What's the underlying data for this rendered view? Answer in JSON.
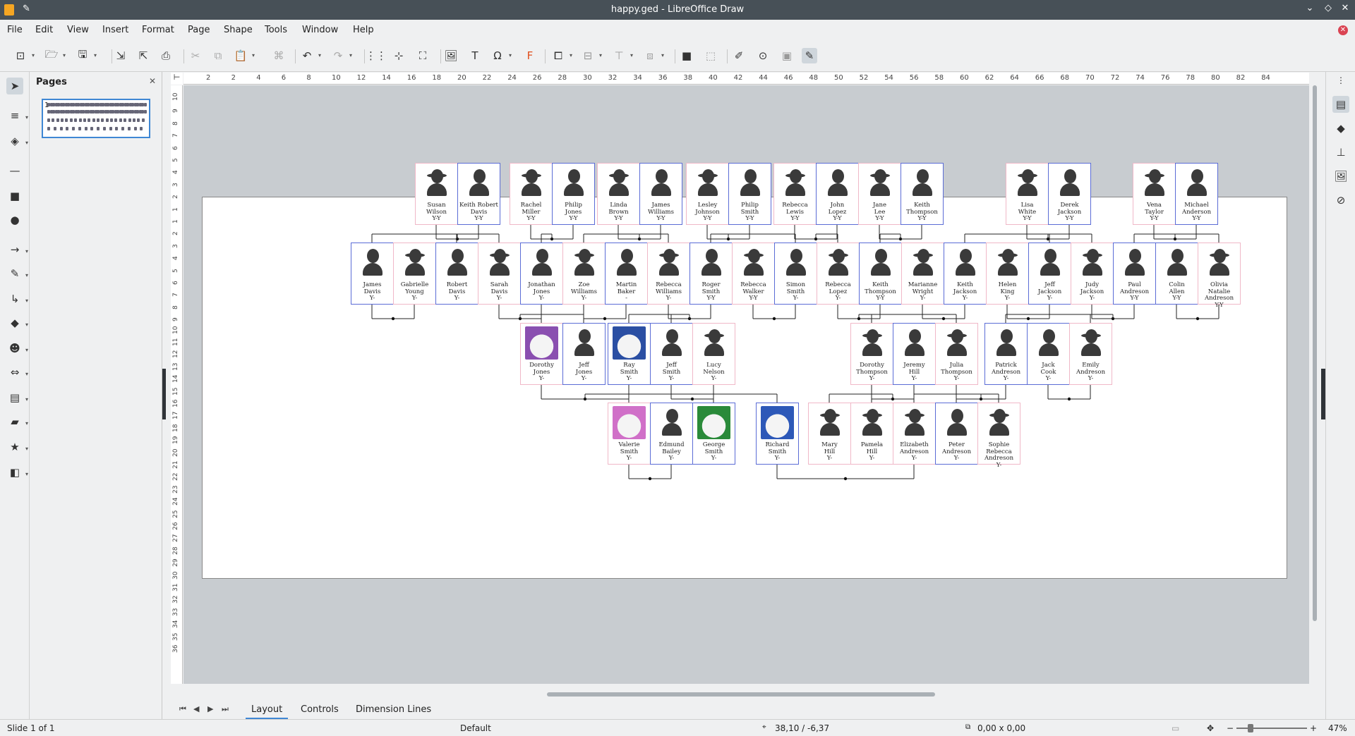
{
  "window": {
    "title": "happy.ged - LibreOffice Draw"
  },
  "menu": [
    "File",
    "Edit",
    "View",
    "Insert",
    "Format",
    "Page",
    "Shape",
    "Tools",
    "Window",
    "Help"
  ],
  "pages_panel": {
    "title": "Pages",
    "page_number": "1"
  },
  "ruler_h": [
    "2",
    "2",
    "4",
    "6",
    "8",
    "10",
    "12",
    "14",
    "16",
    "18",
    "20",
    "22",
    "24",
    "26",
    "28",
    "30",
    "32",
    "34",
    "36",
    "38",
    "40",
    "42",
    "44",
    "46",
    "48",
    "50",
    "52",
    "54",
    "56",
    "58",
    "60",
    "62",
    "64",
    "66",
    "68",
    "70",
    "72",
    "74",
    "76",
    "78",
    "80",
    "82",
    "84"
  ],
  "ruler_v": [
    "10",
    "9",
    "8",
    "7",
    "6",
    "5",
    "4",
    "3",
    "2",
    "1",
    "1",
    "2",
    "3",
    "4",
    "5",
    "6",
    "7",
    "8",
    "9",
    "10",
    "11",
    "12",
    "13",
    "14",
    "15",
    "16",
    "17",
    "18",
    "19",
    "20",
    "21",
    "22",
    "23",
    "24",
    "25",
    "26",
    "27",
    "28",
    "29",
    "30",
    "31",
    "32",
    "33",
    "34",
    "35",
    "36"
  ],
  "people": {
    "g1": [
      {
        "name": "Susan\nWilson\nY-Y",
        "sex": "f"
      },
      {
        "name": "Keith Robert\nDavis\nY-Y",
        "sex": "m"
      },
      {
        "name": "Rachel\nMiller\nY-Y",
        "sex": "f"
      },
      {
        "name": "Philip\nJones\nY-Y",
        "sex": "m"
      },
      {
        "name": "Linda\nBrown\nY-Y",
        "sex": "f"
      },
      {
        "name": "James\nWilliams\nY-Y",
        "sex": "m"
      },
      {
        "name": "Lesley\nJohnson\nY-Y",
        "sex": "f"
      },
      {
        "name": "Philip\nSmith\nY-Y",
        "sex": "m"
      },
      {
        "name": "Rebecca\nLewis\nY-Y",
        "sex": "f"
      },
      {
        "name": "John\nLopez\nY-Y",
        "sex": "m"
      },
      {
        "name": "Jane\nLee\nY-Y",
        "sex": "f"
      },
      {
        "name": "Keith\nThompson\nY-Y",
        "sex": "m"
      },
      {
        "name": "Lisa\nWhite\nY-Y",
        "sex": "f"
      },
      {
        "name": "Derek\nJackson\nY-Y",
        "sex": "m"
      },
      {
        "name": "Vena\nTaylor\nY-Y",
        "sex": "f"
      },
      {
        "name": "Michael\nAnderson\nY-Y",
        "sex": "m"
      }
    ],
    "g2": [
      {
        "name": "James\nDavis\nY-",
        "sex": "m"
      },
      {
        "name": "Gabrielle\nYoung\nY-",
        "sex": "f"
      },
      {
        "name": "Robert\nDavis\nY-",
        "sex": "m"
      },
      {
        "name": "Sarah\nDavis\nY-",
        "sex": "f"
      },
      {
        "name": "Jonathan\nJones\nY-",
        "sex": "m"
      },
      {
        "name": "Zoe\nWilliams\nY-",
        "sex": "f"
      },
      {
        "name": "Martin\nBaker\n-",
        "sex": "m"
      },
      {
        "name": "Rebecca\nWilliams\nY-",
        "sex": "f"
      },
      {
        "name": "Roger\nSmith\nY-Y",
        "sex": "m"
      },
      {
        "name": "Rebecca\nWalker\nY-Y",
        "sex": "f"
      },
      {
        "name": "Simon\nSmith\nY-",
        "sex": "m"
      },
      {
        "name": "Rebecca\nLopez\nY-",
        "sex": "f"
      },
      {
        "name": "Keith\nThompson\nY-Y",
        "sex": "m"
      },
      {
        "name": "Marianne\nWright\nY-",
        "sex": "f"
      },
      {
        "name": "Keith\nJackson\nY-",
        "sex": "m"
      },
      {
        "name": "Helen\nKing\nY-",
        "sex": "f"
      },
      {
        "name": "Jeff\nJackson\nY-",
        "sex": "m"
      },
      {
        "name": "Judy\nJackson\nY-",
        "sex": "f"
      },
      {
        "name": "Paul\nAndreson\nY-Y",
        "sex": "m"
      },
      {
        "name": "Colin\nAllen\nY-Y",
        "sex": "m"
      },
      {
        "name": "Olivia Natalie\nAndreson\nY-Y",
        "sex": "f"
      }
    ],
    "g3": [
      {
        "name": "Dorothy\nJones\nY-",
        "sex": "f",
        "photo": "dorothy"
      },
      {
        "name": "Jeff\nJones\nY-",
        "sex": "m"
      },
      {
        "name": "Ray\nSmith\nY-",
        "sex": "m",
        "photo": "ray"
      },
      {
        "name": "Jeff\nSmith\nY-",
        "sex": "m"
      },
      {
        "name": "Lucy\nNelson\nY-",
        "sex": "f"
      },
      {
        "name": "Dorothy\nThompson\nY-",
        "sex": "f"
      },
      {
        "name": "Jeremy\nHill\nY-",
        "sex": "m"
      },
      {
        "name": "Julia\nThompson\nY-",
        "sex": "f"
      },
      {
        "name": "Patrick\nAndreson\nY-",
        "sex": "m"
      },
      {
        "name": "Jack\nCook\nY-",
        "sex": "m"
      },
      {
        "name": "Emily\nAndreson\nY-",
        "sex": "f"
      }
    ],
    "g4": [
      {
        "name": "Valerie\nSmith\nY-",
        "sex": "f",
        "photo": "valerie"
      },
      {
        "name": "Edmund\nBailey\nY-",
        "sex": "m"
      },
      {
        "name": "George\nSmith\nY-",
        "sex": "m",
        "photo": "george"
      },
      {
        "name": "Richard\nSmith\nY-",
        "sex": "m",
        "photo": "richard"
      },
      {
        "name": "Mary\nHill\nY-",
        "sex": "f"
      },
      {
        "name": "Pamela\nHill\nY-",
        "sex": "f"
      },
      {
        "name": "Elizabeth\nAndreson\nY-",
        "sex": "f"
      },
      {
        "name": "Peter\nAndreson\nY-",
        "sex": "m"
      },
      {
        "name": "Sophie Rebecca\nAndreson\nY-",
        "sex": "f"
      }
    ]
  },
  "tabs": [
    "Layout",
    "Controls",
    "Dimension Lines"
  ],
  "status": {
    "slide": "Slide 1 of 1",
    "layout": "Default",
    "position": "38,10 / -6,37",
    "size": "0,00 x 0,00",
    "zoom": "47%"
  },
  "colors": {
    "female_border": "#f0b8c8",
    "male_border": "#5b6cd6",
    "accent": "#3f87d4"
  }
}
